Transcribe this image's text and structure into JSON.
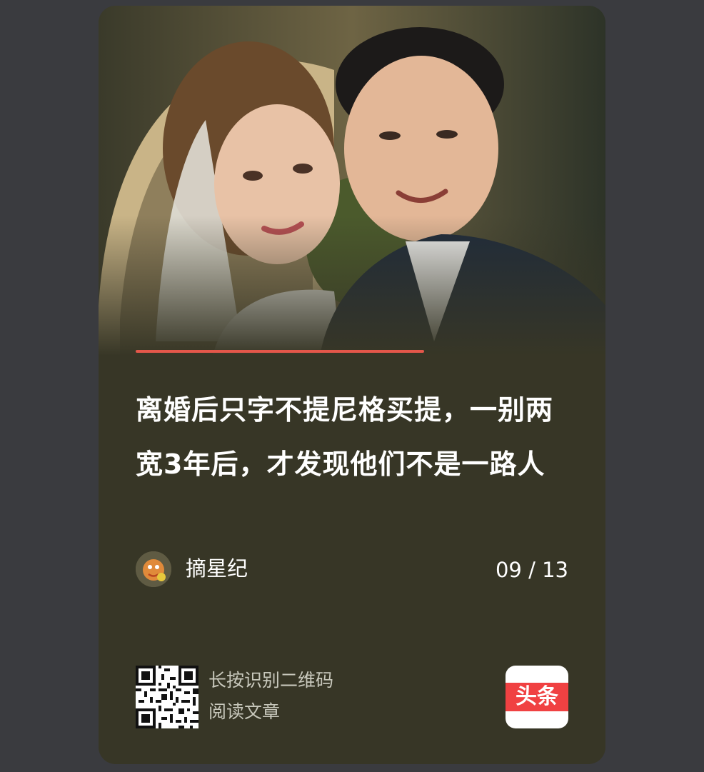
{
  "article": {
    "title": "离婚后只字不提尼格买提，一别两宽3年后，才发现他们不是一路人",
    "author": "摘星纪",
    "page_indicator": "09 / 13"
  },
  "qr": {
    "line1": "长按识别二维码",
    "line2": "阅读文章"
  },
  "logo": {
    "text": "头条"
  },
  "colors": {
    "page_background": "#3a3b3f",
    "card_background": "#373626",
    "accent_line": "#e4574a",
    "logo_red": "#f04142"
  },
  "icons": {
    "logo": "toutiao-logo-icon",
    "qr": "qr-code-icon",
    "avatar": "author-avatar"
  }
}
